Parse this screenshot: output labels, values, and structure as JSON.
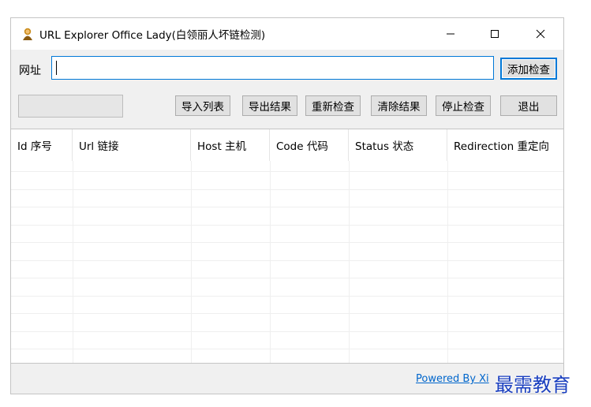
{
  "window": {
    "title": "URL Explorer Office Lady(白领丽人坏链检测)",
    "min_glyph": "—",
    "max_glyph": "☐",
    "close_glyph": "✕"
  },
  "url_bar": {
    "label": "网址",
    "value": "",
    "add_button": "添加检查"
  },
  "toolbar": {
    "progress": 0,
    "import": "导入列表",
    "export": "导出结果",
    "recheck": "重新检查",
    "clear": "清除结果",
    "stop": "停止检查",
    "exit": "退出"
  },
  "table": {
    "columns": [
      "Id 序号",
      "Url 链接",
      "Host 主机",
      "Code 代码",
      "Status 状态",
      "Redirection 重定向"
    ],
    "rows": []
  },
  "status": {
    "powered_by": "Powered By Xi"
  },
  "watermark": "最需教育",
  "colors": {
    "accent": "#0078d7",
    "link": "#0066cc",
    "watermark": "#1a3fbf"
  }
}
